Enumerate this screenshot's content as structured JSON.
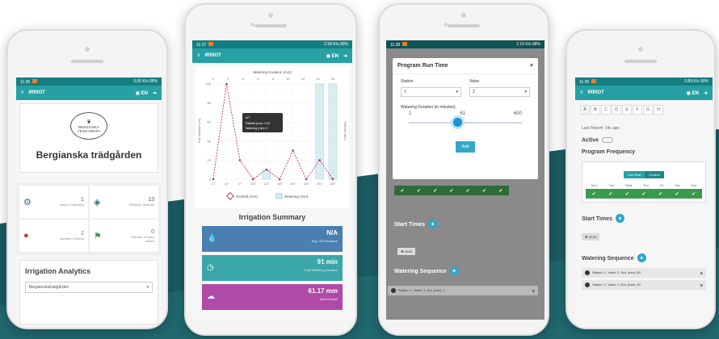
{
  "colors": {
    "teal": "#26a0a3",
    "dark_teal": "#1b5c63",
    "blue_card": "#4a7fb0",
    "teal_card": "#3aa6a8",
    "purple_card": "#b04aa8",
    "green": "#3a9a4c"
  },
  "status_bar": {
    "p1_left": "11:35",
    "p1_right": "0.06 K/s 89%",
    "p2_left": "11:37",
    "p2_right": "2.58 K/s 90%",
    "p3_left": "11:38",
    "p3_right": "2.16 K/s 88%",
    "p4_left": "11:35",
    "p4_right": "0.89 K/s 90%"
  },
  "app": {
    "name": "IRRIOT",
    "lang": "EN",
    "menu_icon": "hamburger-icon"
  },
  "phone1": {
    "logo_line1": "BERGIANSKA",
    "logo_line2": "TRÄDGÅRDEN",
    "title": "Bergianska trädgården",
    "stats": [
      {
        "icon": "controllers-icon",
        "value": "1",
        "label": "Base Controllers"
      },
      {
        "icon": "box-icon",
        "value": "13",
        "label": "Wireless Stations"
      },
      {
        "icon": "alert-icon",
        "value": "2",
        "label": "Number of Alerts"
      },
      {
        "icon": "valve-icon",
        "value": "0",
        "label": "Number of open valves"
      }
    ],
    "analytics_title": "Irrigation Analytics",
    "analytics_select": "Bergianskaträdgården"
  },
  "phone2": {
    "chart_title": "Watering Duration (min)",
    "left_axis": "Soil Moisture (%)",
    "right_axis": "Rainfall (mm)",
    "tooltip_date": "4/7",
    "tooltip_line1": "Rainfall (mm): 0.00",
    "tooltip_line2": "Watering (min): 0",
    "legend_rain": "Rainfall (mm)",
    "legend_water": "Watering (min)",
    "summary_title": "Irrigation Summary",
    "cards": [
      {
        "value": "N/A",
        "label": "Avg. Soil Moisture",
        "icon": "drop-icon"
      },
      {
        "value": "91 min",
        "label": "Total Watering Duration",
        "icon": "clock-icon"
      },
      {
        "value": "61.17 mm",
        "label": "Total Rainfall",
        "icon": "cloud-icon"
      }
    ]
  },
  "chart_data": {
    "type": "line",
    "title": "Watering Duration (min)",
    "categories": [
      "1/7",
      "4/7",
      "7/7",
      "10/7",
      "13/7",
      "16/7",
      "19/7",
      "22/7",
      "25/7",
      "28/7"
    ],
    "top_ticks": [
      "0",
      "2",
      "4",
      "6",
      "8",
      "10",
      "12",
      "14",
      "16"
    ],
    "left_ticks": [
      "0",
      "20",
      "40",
      "60",
      "80",
      "100"
    ],
    "series": [
      {
        "name": "Rainfall (mm)",
        "values": [
          0,
          100,
          20,
          0,
          10,
          0,
          30,
          0,
          20,
          0
        ]
      },
      {
        "name": "Watering (min)",
        "values": [
          0,
          0,
          0,
          0,
          10,
          0,
          0,
          0,
          100,
          100
        ]
      }
    ],
    "ylim": [
      0,
      100
    ]
  },
  "phone3": {
    "modal_title": "Program Run Time",
    "close": "×",
    "station_label": "Station",
    "valve_label": "Valve",
    "station_value": "1",
    "valve_value": "2",
    "duration_label": "Watering Duration (in minutes)",
    "slider_min": "1",
    "slider_value": "61",
    "slider_max": "600",
    "slider_fraction": 0.1,
    "add_label": "Add",
    "start_times_label": "Start Times",
    "start_time_chip": "✖ 00:00",
    "watering_sequence_label": "Watering Sequence",
    "sequence_item": "Station: 1, Valve: 1, Dur. (min): 1"
  },
  "phone4": {
    "letters": [
      "A",
      "B",
      "C",
      "D",
      "E",
      "F",
      "G",
      "H"
    ],
    "last_report": "Last Report: 14s ago",
    "active_label": "Active",
    "program_frequency_label": "Program Frequency",
    "freq_options": [
      "Use Rest",
      "Custom"
    ],
    "days": [
      "Mon",
      "Tue",
      "Wed",
      "Thu",
      "Fri",
      "Sat",
      "Sun"
    ],
    "start_times_label": "Start Times",
    "start_time_chip": "✖ 22:00",
    "watering_sequence_label": "Watering Sequence",
    "sequence_items": [
      "Station: 1, Valve: 2, Dur. (min): 60",
      "Station: 2, Valve: 1, Dur. (min): 30"
    ]
  }
}
